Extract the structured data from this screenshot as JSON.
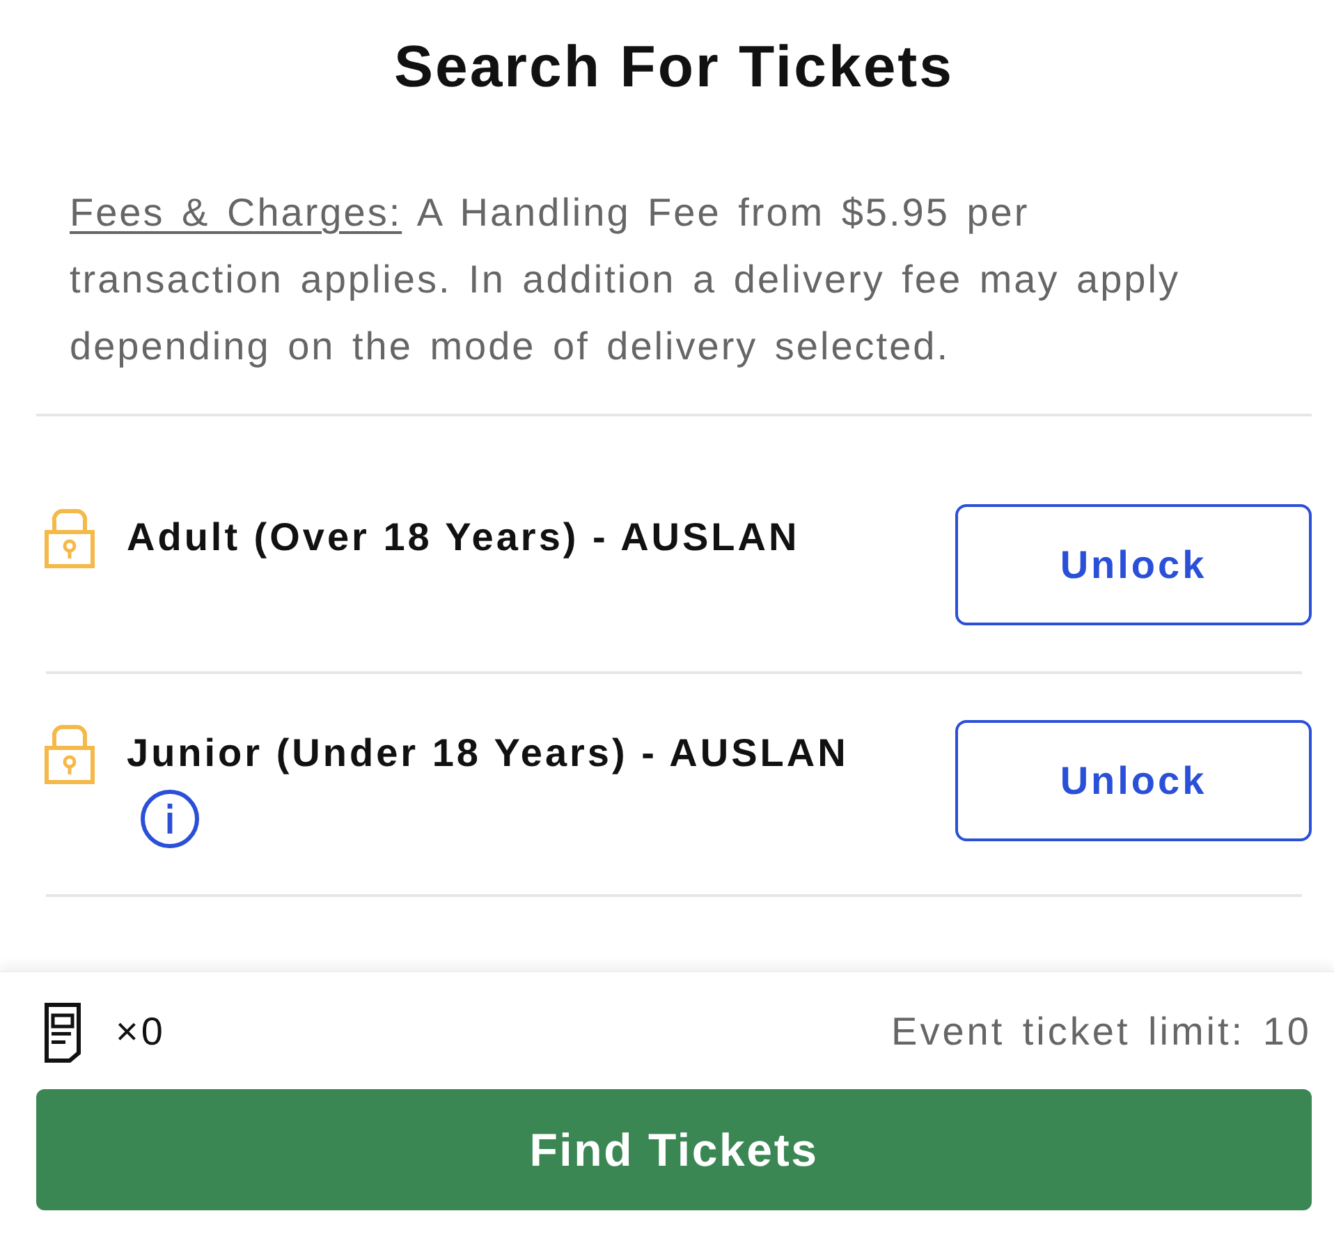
{
  "title": "Search For Tickets",
  "fees_note": {
    "link": "Fees & Charges:",
    "text": "A Handling Fee from $5.95 per transaction applies. In addition a delivery fee may apply depending on the mode of delivery selected."
  },
  "ticket_types": [
    {
      "label": "Adult (Over 18 Years) - AUSLAN",
      "locked": true,
      "info": false,
      "button": "Unlock"
    },
    {
      "label": "Junior (Under 18 Years) - AUSLAN",
      "locked": true,
      "info": true,
      "button": "Unlock"
    }
  ],
  "footer": {
    "ticket_count": "×0",
    "limit": "Event ticket limit: 10",
    "button": "Find Tickets"
  }
}
